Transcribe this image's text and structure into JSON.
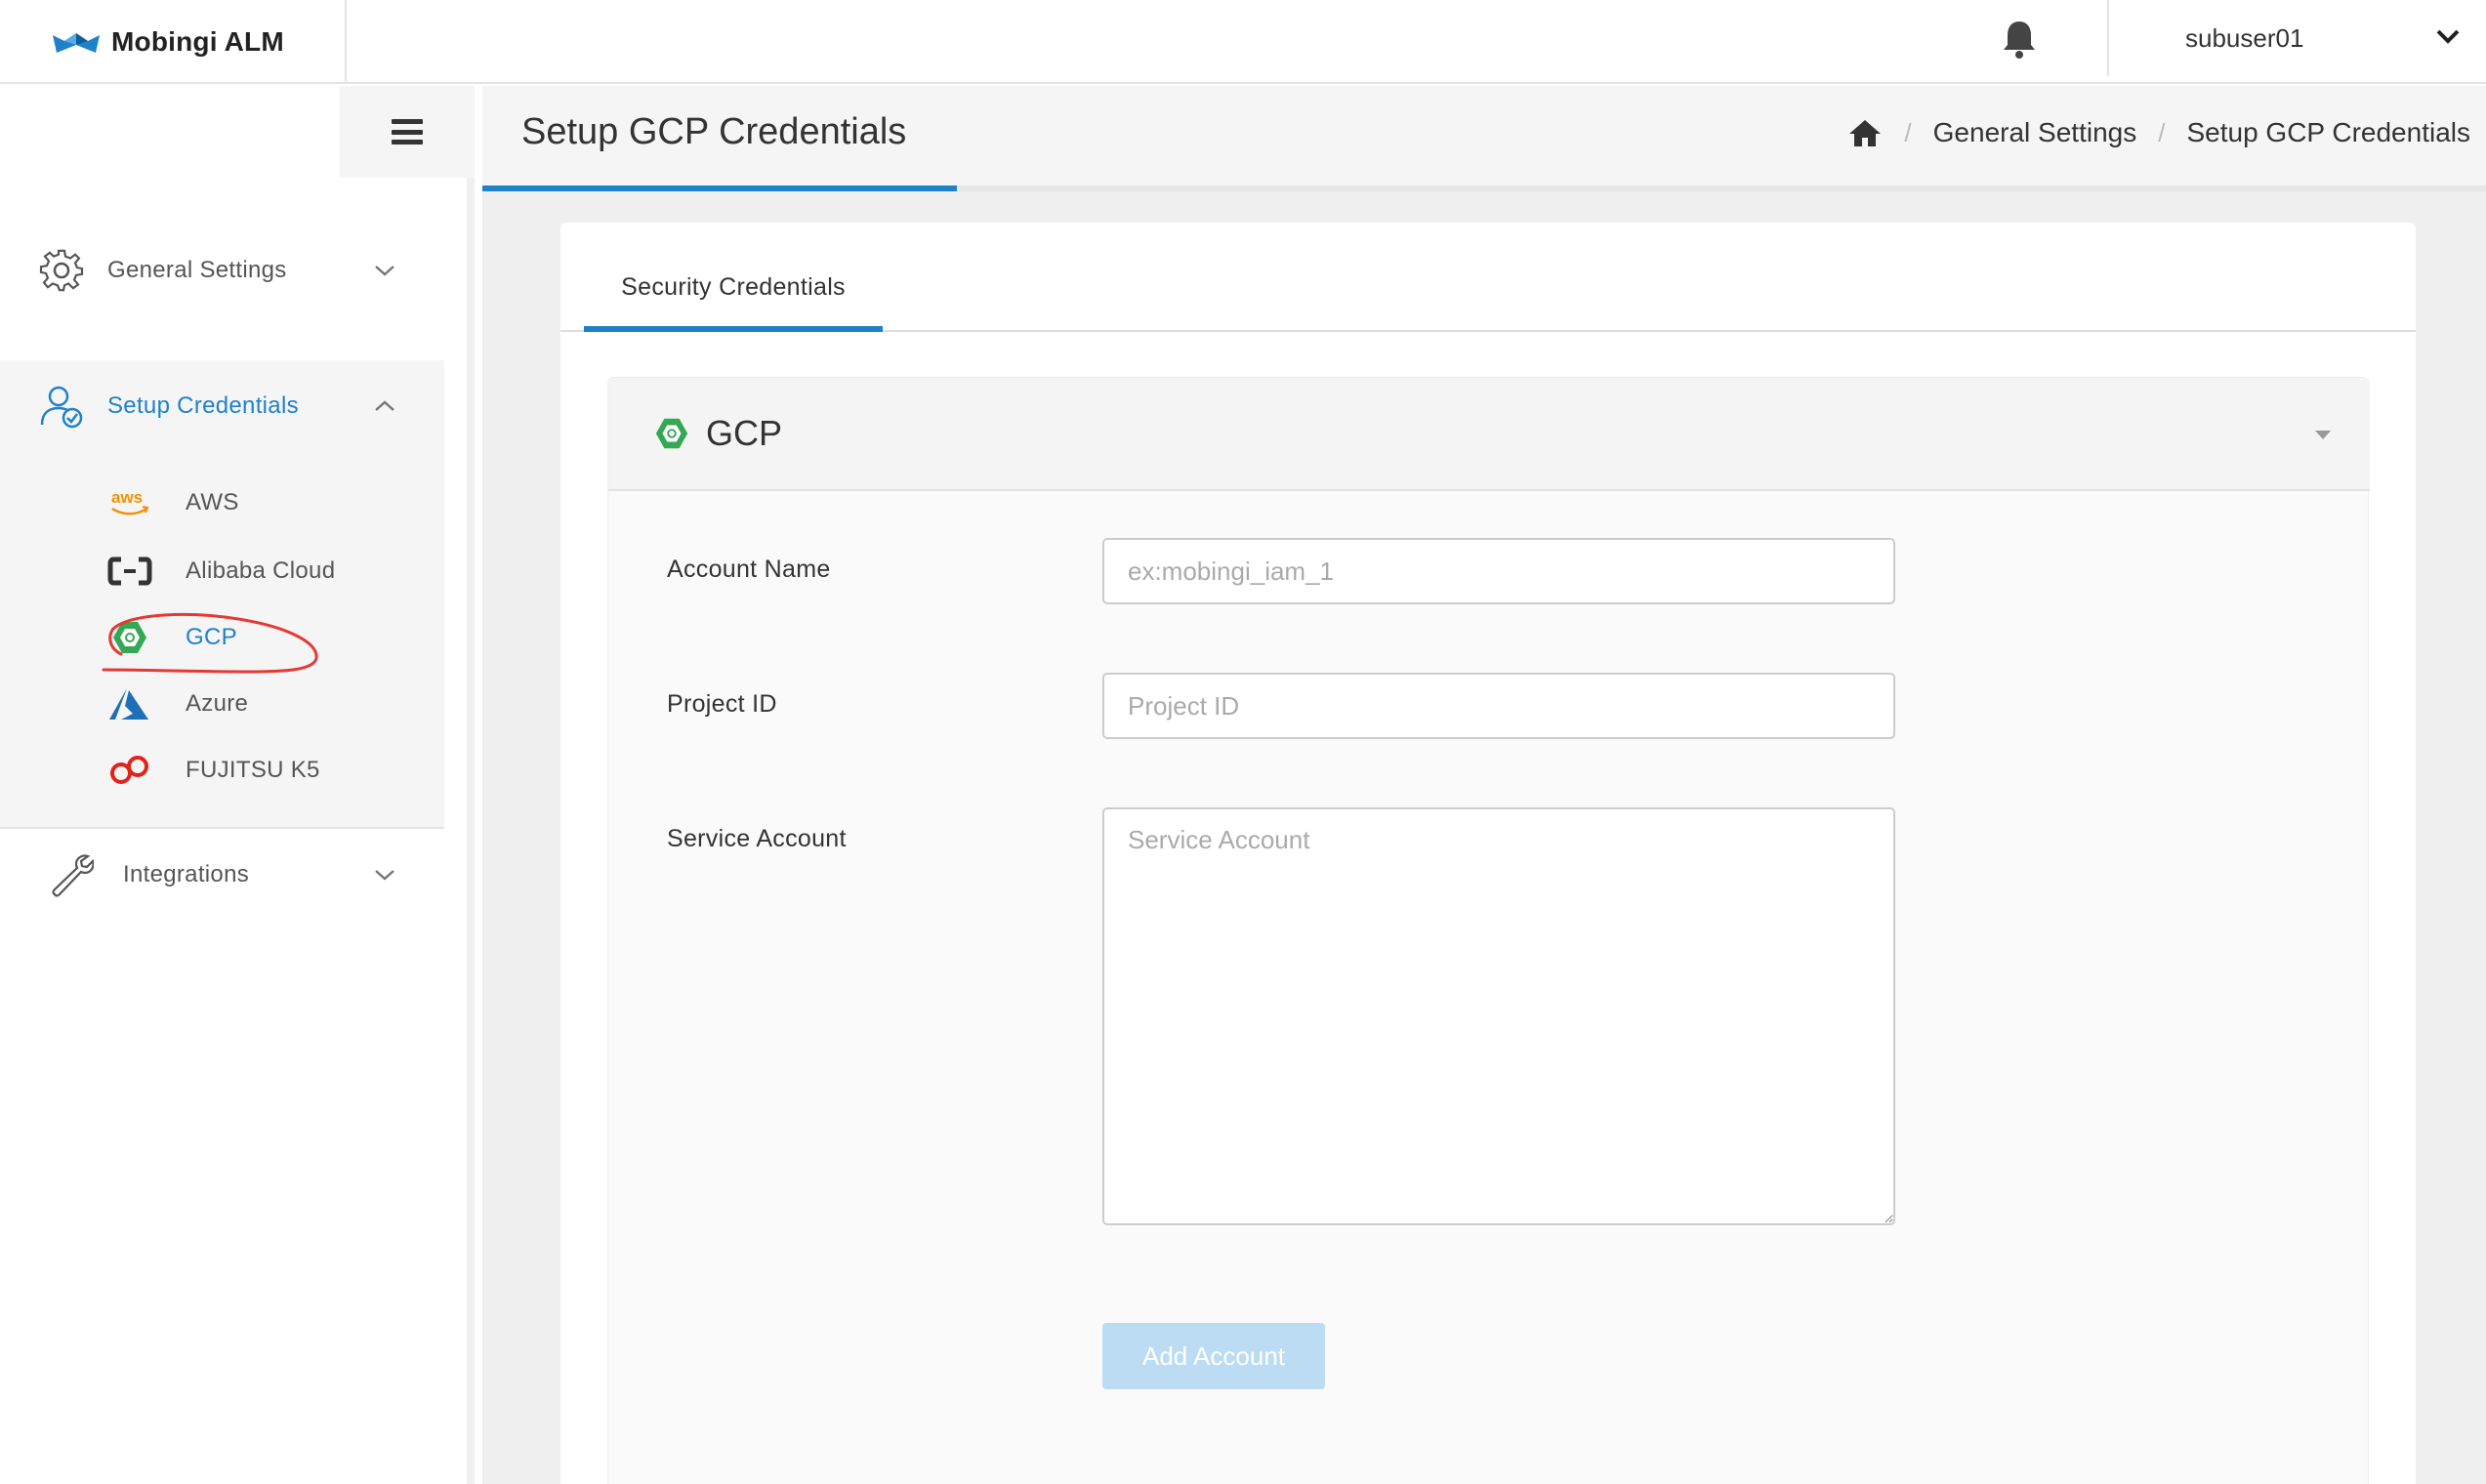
{
  "app": {
    "name": "Mobingi ALM"
  },
  "topbar": {
    "username": "subuser01",
    "bell_icon": "bell-icon",
    "user_menu_icon": "chevron-down-icon"
  },
  "sidebar": {
    "toggle_icon": "hamburger-icon",
    "items": [
      {
        "label": "General Settings",
        "icon": "gear-icon",
        "expanded": false
      },
      {
        "label": "Setup Credentials",
        "icon": "user-check-icon",
        "expanded": true,
        "children": [
          {
            "label": "AWS",
            "icon": "aws-logo-icon"
          },
          {
            "label": "Alibaba Cloud",
            "icon": "alibaba-cloud-logo-icon"
          },
          {
            "label": "GCP",
            "icon": "gcp-logo-icon",
            "active": true
          },
          {
            "label": "Azure",
            "icon": "azure-logo-icon"
          },
          {
            "label": "FUJITSU K5",
            "icon": "fujitsu-k5-logo-icon"
          }
        ]
      },
      {
        "label": "Integrations",
        "icon": "wrench-icon",
        "expanded": false
      }
    ]
  },
  "page": {
    "title": "Setup GCP Credentials",
    "breadcrumb": [
      "General Settings",
      "Setup GCP Credentials"
    ],
    "home_icon": "home-icon"
  },
  "tabs": [
    {
      "label": "Security Credentials",
      "active": true
    }
  ],
  "panel": {
    "title": "GCP",
    "fields": {
      "account_name": {
        "label": "Account Name",
        "placeholder": "ex:mobingi_iam_1",
        "value": ""
      },
      "project_id": {
        "label": "Project ID",
        "placeholder": "Project ID",
        "value": ""
      },
      "service_account": {
        "label": "Service Account",
        "placeholder": "Service Account",
        "value": ""
      }
    },
    "submit_label": "Add Account",
    "submit_disabled": true
  },
  "colors": {
    "accent": "#1e82c8",
    "annotation": "#e53935",
    "aws": "#f29100",
    "gcp": "#34a853",
    "azure": "#1e6fb5",
    "fujitsu": "#e2231a"
  }
}
